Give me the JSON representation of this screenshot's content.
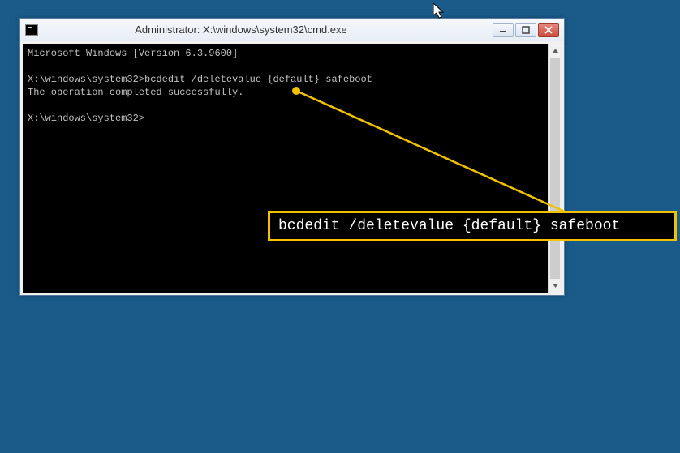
{
  "window": {
    "title": "Administrator: X:\\windows\\system32\\cmd.exe"
  },
  "terminal": {
    "line1": "Microsoft Windows [Version 6.3.9600]",
    "line2": "",
    "line3": "X:\\windows\\system32>bcdedit /deletevalue {default} safeboot",
    "line4": "The operation completed successfully.",
    "line5": "",
    "line6": "X:\\windows\\system32>"
  },
  "callout": {
    "text": "bcdedit /deletevalue {default} safeboot"
  },
  "colors": {
    "desktop": "#1a5b8a",
    "highlight": "#f2c200"
  }
}
